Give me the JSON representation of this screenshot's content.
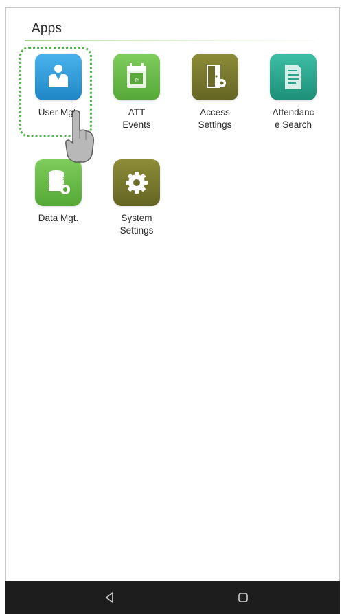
{
  "header": {
    "title": "Apps"
  },
  "apps": [
    {
      "label": "User Mgt.",
      "icon": "user-icon",
      "color": "#2e9bd6"
    },
    {
      "label": "ATT\nEvents",
      "icon": "calendar-icon",
      "color": "#6cbf4a"
    },
    {
      "label": "Access\nSettings",
      "icon": "door-gear-icon",
      "color": "#7a7a2e"
    },
    {
      "label": "Attendanc\ne Search",
      "icon": "document-search-icon",
      "color": "#2aa58f"
    },
    {
      "label": "Data Mgt.",
      "icon": "database-gear-icon",
      "color": "#6cbf4a"
    },
    {
      "label": "System\nSettings",
      "icon": "gear-icon",
      "color": "#7a7a2e"
    }
  ],
  "selection_color": "#4fb848",
  "navbar": {
    "back": "back-icon",
    "home": "home-icon"
  }
}
